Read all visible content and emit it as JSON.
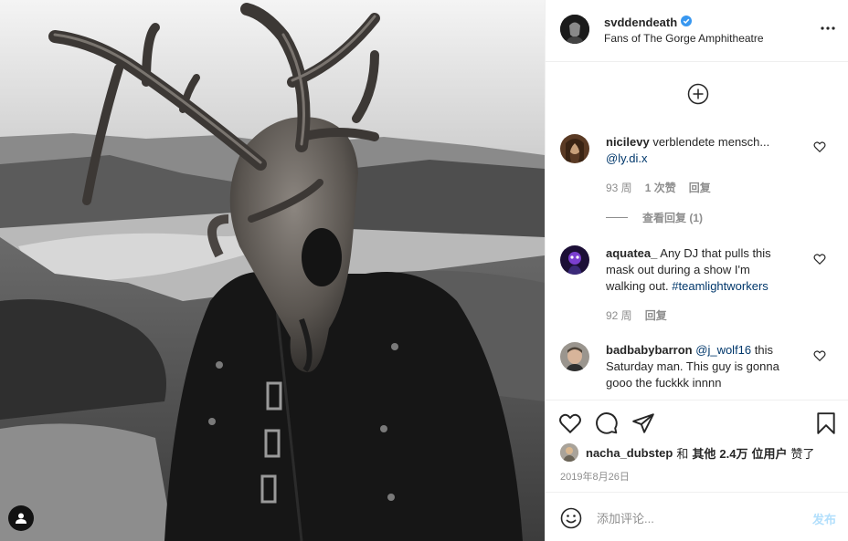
{
  "post": {
    "owner": {
      "username": "svddendeath",
      "verified": true,
      "location": "Fans of The Gorge Amphitheatre"
    },
    "actions_menu_icon": "more-horizontal-icon",
    "load_more_icon": "plus-circle-icon",
    "comments": [
      {
        "username": "nicilevy",
        "text": "verblendete mensch...",
        "mention": "@ly.di.x",
        "time": "93 周",
        "likes": "1 次赞",
        "reply": "回复",
        "view_replies": "查看回复 (1)"
      },
      {
        "username": "aquatea_",
        "text_lines": [
          "Any DJ that pulls this",
          "mask out during a show I'm",
          "walking out."
        ],
        "hashtag": "#teamlightworkers",
        "time": "92 周",
        "reply": "回复"
      },
      {
        "username": "badbabybarron",
        "mention": "@j_wolf16",
        "text_lines": [
          "this",
          "Saturday man. This guy is gonna",
          "gooo the fuckkk innnn"
        ]
      }
    ],
    "action_icons": [
      "heart-icon",
      "comment-icon",
      "share-icon",
      "bookmark-icon"
    ],
    "likes_line": {
      "user": "nacha_dubstep",
      "and": "和",
      "others": "其他",
      "count": "2.4万",
      "suffix_users": "位用户",
      "liked": "赞了"
    },
    "date": "2019年8月26日",
    "add_comment_placeholder": "添加评论...",
    "post_button": "发布",
    "colors": {
      "link": "#00376b",
      "verified": "#3897f0",
      "post_button_disabled": "#b2dffc",
      "secondary_text": "#8e8e8e"
    }
  }
}
